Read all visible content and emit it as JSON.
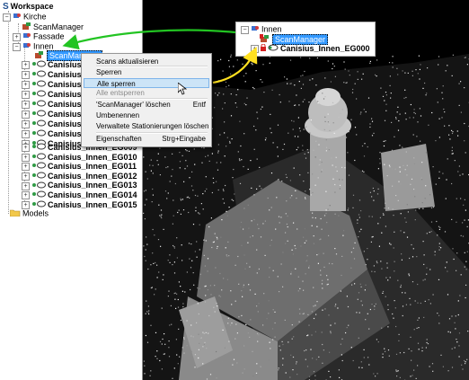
{
  "tree": {
    "root": "Workspace",
    "kirche": "Kirche",
    "scanmanager_top": "ScanManager",
    "fassade": "Fassade",
    "innen": "Innen",
    "scanmanager_selected": "ScanManager",
    "partial_rows": [
      "Canisius_I",
      "Canisius_I",
      "Canisius_I",
      "Canisius_I",
      "Canisius_I",
      "Canisius_I",
      "Canisius_I",
      "Canisius_I",
      "Canisius_I"
    ],
    "scans": [
      "Canisius_Innen_EG009",
      "Canisius_Innen_EG010",
      "Canisius_Innen_EG011",
      "Canisius_Innen_EG012",
      "Canisius_Innen_EG013",
      "Canisius_Innen_EG014",
      "Canisius_Innen_EG015"
    ],
    "models": "Models"
  },
  "context_menu": {
    "items": [
      {
        "label": "Scans aktualisieren",
        "shortcut": ""
      },
      {
        "label": "Sperren",
        "shortcut": ""
      },
      {
        "label": "Alle sperren",
        "shortcut": ""
      },
      {
        "label": "Alle entsperren",
        "shortcut": ""
      },
      {
        "label": "'ScanManager' löschen",
        "shortcut": "Entf"
      },
      {
        "label": "Umbenennen",
        "shortcut": ""
      },
      {
        "label": "Verwaltete Stationierungen löschen",
        "shortcut": ""
      },
      {
        "label": "Eigenschaften",
        "shortcut": "Strg+Eingabe"
      }
    ]
  },
  "inset": {
    "innen": "Innen",
    "scanmanager": "ScanManager",
    "scan": "Canisius_Innen_EG000"
  },
  "colors": {
    "selection": "#3399ff",
    "arrow_green": "#22c422",
    "arrow_yellow": "#ffe020",
    "lock_red": "#d42020",
    "folder_yellow": "#f2c84b"
  }
}
